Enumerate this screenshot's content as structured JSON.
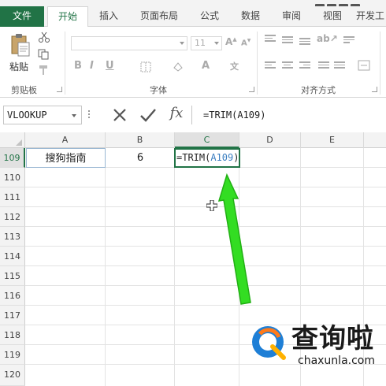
{
  "ribbon": {
    "tabs": [
      {
        "label": "文件"
      },
      {
        "label": "开始"
      },
      {
        "label": "插入"
      },
      {
        "label": "页面布局"
      },
      {
        "label": "公式"
      },
      {
        "label": "数据"
      },
      {
        "label": "审阅"
      },
      {
        "label": "视图"
      },
      {
        "label": "开发工"
      }
    ],
    "active_tab": "开始",
    "clipboard": {
      "paste_label": "粘贴",
      "group_label": "剪贴板"
    },
    "font": {
      "group_label": "字体",
      "size_value": "11",
      "bold": "B",
      "italic": "I",
      "underline": "U"
    },
    "alignment": {
      "group_label": "对齐方式"
    }
  },
  "formula_bar": {
    "name_box": "VLOOKUP",
    "cancel_icon": "x-icon",
    "enter_icon": "check-icon",
    "fx_label": "fx",
    "formula": "=TRIM(A109)"
  },
  "sheet": {
    "columns": [
      "A",
      "B",
      "C",
      "D",
      "E"
    ],
    "active_column": "C",
    "rows": [
      "109",
      "110",
      "111",
      "112",
      "113",
      "114",
      "115",
      "116",
      "117",
      "118",
      "119",
      "120"
    ],
    "active_row": "109",
    "cells": {
      "A109": "搜狗指南",
      "B109": "6",
      "C109_prefix": "=TRIM(",
      "C109_ref": "A109",
      "C109_suffix": ")"
    },
    "ref_color": "#3c7fc1",
    "accent": "#217346"
  },
  "annotation": {
    "arrow_color": "#33dd22"
  },
  "watermark": {
    "title": "查询啦",
    "url": "chaxunla.com"
  }
}
